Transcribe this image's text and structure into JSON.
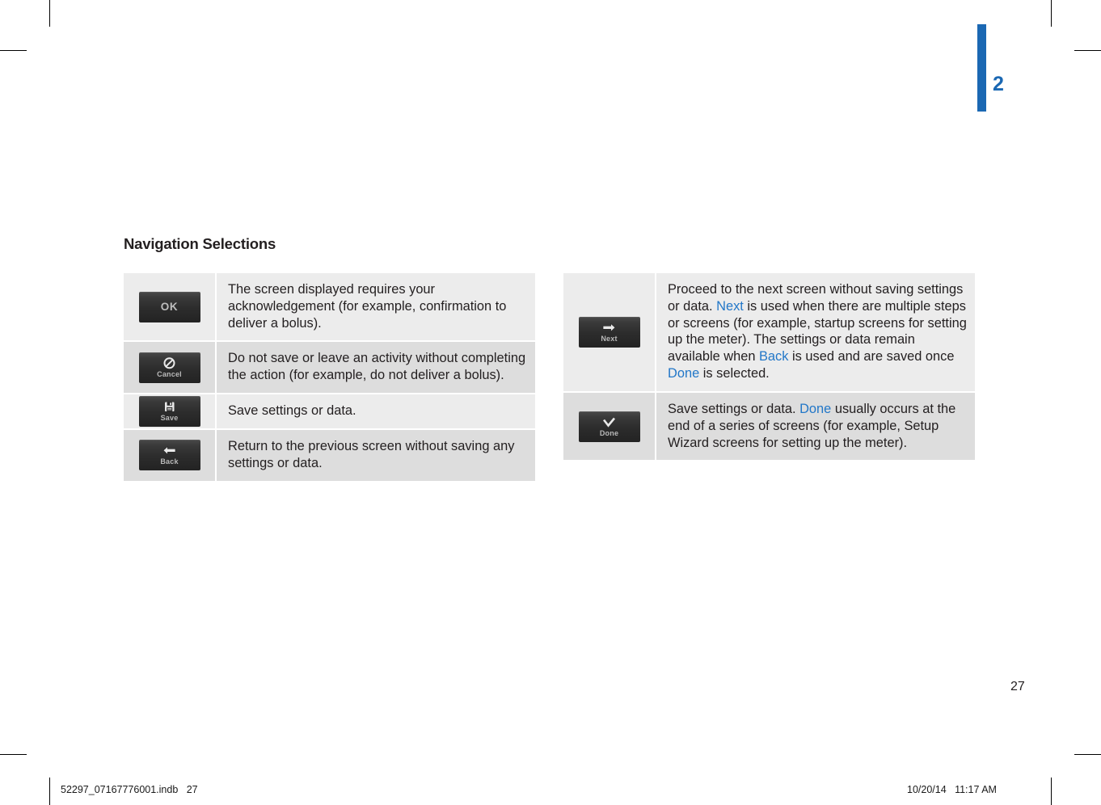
{
  "page": {
    "chapter_number": "2",
    "page_number": "27",
    "section_heading": "Navigation Selections"
  },
  "footer": {
    "file_label": "52297_07167776001.indb   27",
    "timestamp": "10/20/14   11:17 AM"
  },
  "colors": {
    "accent_blue": "#1b68b3",
    "link_blue": "#2277c8",
    "row_light": "#ececec",
    "row_dark": "#dddddd",
    "button_dark": "#2c2c2c"
  },
  "tables": {
    "left": {
      "rows": [
        {
          "icon_name": "ok-button",
          "button_label": "OK",
          "button_style": "text-only",
          "description": "The screen displayed requires your acknowledgement (for example, confirmation to deliver a bolus)."
        },
        {
          "icon_name": "cancel-button",
          "button_label": "Cancel",
          "button_style": "glyph",
          "glyph": "prohibition-icon",
          "description": "Do not save or leave an activity without completing the action (for example, do not deliver a bolus)."
        },
        {
          "icon_name": "save-button",
          "button_label": "Save",
          "button_style": "glyph",
          "glyph": "floppy-disk-icon",
          "description": "Save settings or data."
        },
        {
          "icon_name": "back-button",
          "button_label": "Back",
          "button_style": "glyph",
          "glyph": "arrow-left-icon",
          "description": "Return to the previous screen without saving any settings or data."
        }
      ]
    },
    "right": {
      "rows": [
        {
          "icon_name": "next-button",
          "button_label": "Next",
          "button_style": "glyph",
          "glyph": "arrow-right-icon",
          "description_parts": [
            {
              "text": "Proceed to the next screen without saving settings or data. ",
              "highlight": false
            },
            {
              "text": "Next",
              "highlight": true
            },
            {
              "text": " is used when there are multiple steps or screens (for example, startup screens for setting up the meter). The settings or data remain available when ",
              "highlight": false
            },
            {
              "text": "Back",
              "highlight": true
            },
            {
              "text": " is used and are saved once ",
              "highlight": false
            },
            {
              "text": "Done",
              "highlight": true
            },
            {
              "text": " is selected.",
              "highlight": false
            }
          ]
        },
        {
          "icon_name": "done-button",
          "button_label": "Done",
          "button_style": "glyph",
          "glyph": "checkmark-icon",
          "description_parts": [
            {
              "text": "Save settings or data. ",
              "highlight": false
            },
            {
              "text": "Done",
              "highlight": true
            },
            {
              "text": " usually occurs at the end of a series of screens (for example, Setup Wizard screens for setting up the meter).",
              "highlight": false
            }
          ]
        }
      ]
    }
  }
}
